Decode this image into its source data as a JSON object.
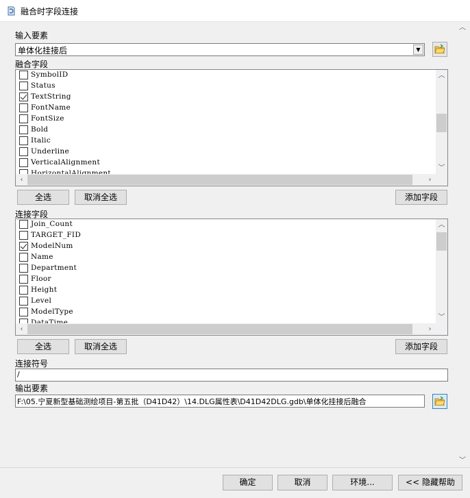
{
  "window": {
    "title": "融合时字段连接"
  },
  "input_features": {
    "label": "输入要素",
    "value": "单体化挂接后"
  },
  "merge_fields": {
    "label": "融合字段",
    "items": [
      {
        "name": "SymbolID",
        "checked": false
      },
      {
        "name": "Status",
        "checked": false
      },
      {
        "name": "TextString",
        "checked": true
      },
      {
        "name": "FontName",
        "checked": false
      },
      {
        "name": "FontSize",
        "checked": false
      },
      {
        "name": "Bold",
        "checked": false
      },
      {
        "name": "Italic",
        "checked": false
      },
      {
        "name": "Underline",
        "checked": false
      },
      {
        "name": "VerticalAlignment",
        "checked": false
      },
      {
        "name": "HorizontalAlignment",
        "checked": false
      }
    ],
    "select_all": "全选",
    "deselect_all": "取消全选",
    "add_field": "添加字段"
  },
  "join_fields": {
    "label": "连接字段",
    "items": [
      {
        "name": "Join_Count",
        "checked": false
      },
      {
        "name": "TARGET_FID",
        "checked": false
      },
      {
        "name": "ModelNum",
        "checked": true
      },
      {
        "name": "Name",
        "checked": false
      },
      {
        "name": "Department",
        "checked": false
      },
      {
        "name": "Floor",
        "checked": false
      },
      {
        "name": "Height",
        "checked": false
      },
      {
        "name": "Level",
        "checked": false
      },
      {
        "name": "ModelType",
        "checked": false
      },
      {
        "name": "DataTime",
        "checked": false
      }
    ],
    "select_all": "全选",
    "deselect_all": "取消全选",
    "add_field": "添加字段"
  },
  "join_symbol": {
    "label": "连接符号",
    "value": "/"
  },
  "output_features": {
    "label": "输出要素",
    "value": "F:\\05.宁夏新型基础测绘项目-第五批（D41D42）\\14.DLG属性表\\D41D42DLG.gdb\\单体化挂接后融合"
  },
  "footer": {
    "ok": "确定",
    "cancel": "取消",
    "environments": "环境...",
    "hide_help": "<< 隐藏帮助"
  },
  "colors": {
    "folder_icon": "#f5c242",
    "accent_border": "#3c7fb1"
  }
}
